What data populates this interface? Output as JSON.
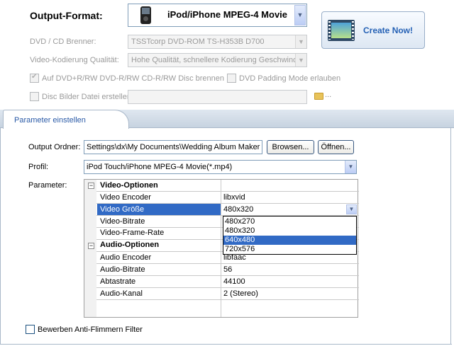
{
  "format": {
    "label": "Output-Format:",
    "value": "iPod/iPhone MPEG-4 Movie",
    "create_button": "Create Now!"
  },
  "burner": {
    "label": "DVD / CD Brenner:",
    "value": "TSSTcorp DVD-ROM TS-H353B D700"
  },
  "quality": {
    "label": "Video-Kodierung Qualität:",
    "value": "Hohe Qualität, schnellere Kodierung Geschwindi"
  },
  "options": {
    "auto_burn": "Auf DVD+R/RW DVD-R/RW CD-R/RW Disc brennen",
    "padding": "DVD Padding Mode erlauben",
    "disc_image": "Disc Bilder Datei ersteller",
    "browse_dots": "..."
  },
  "tab": {
    "label": "Parameter einstellen"
  },
  "output": {
    "label": "Output Ordner:",
    "value": "Settings\\dx\\My Documents\\Wedding Album Maker",
    "browse": "Browsen...",
    "open": "Öffnen..."
  },
  "profile": {
    "label": "Profil:",
    "value": "iPod Touch/iPhone MPEG-4 Movie(*.mp4)"
  },
  "params": {
    "label": "Parameter:",
    "video_header": "Video-Optionen",
    "audio_header": "Audio-Optionen",
    "collapse_glyph": "−",
    "video_rows": [
      {
        "name": "Video Encoder",
        "value": "libxvid"
      },
      {
        "name": "Video Größe",
        "value": "480x320"
      },
      {
        "name": "Video-Bitrate",
        "value": ""
      },
      {
        "name": "Video-Frame-Rate",
        "value": ""
      }
    ],
    "audio_rows": [
      {
        "name": "Audio Encoder",
        "value": "libfaac"
      },
      {
        "name": "Audio-Bitrate",
        "value": "56"
      },
      {
        "name": "Abtastrate",
        "value": "44100"
      },
      {
        "name": "Audio-Kanal",
        "value": "2 (Stereo)"
      }
    ],
    "dropdown_options": [
      "480x270",
      "480x320",
      "640x480",
      "720x576"
    ],
    "dropdown_selected": "640x480"
  },
  "antiflicker": {
    "label": "Bewerben Anti-Flimmern Filter"
  }
}
